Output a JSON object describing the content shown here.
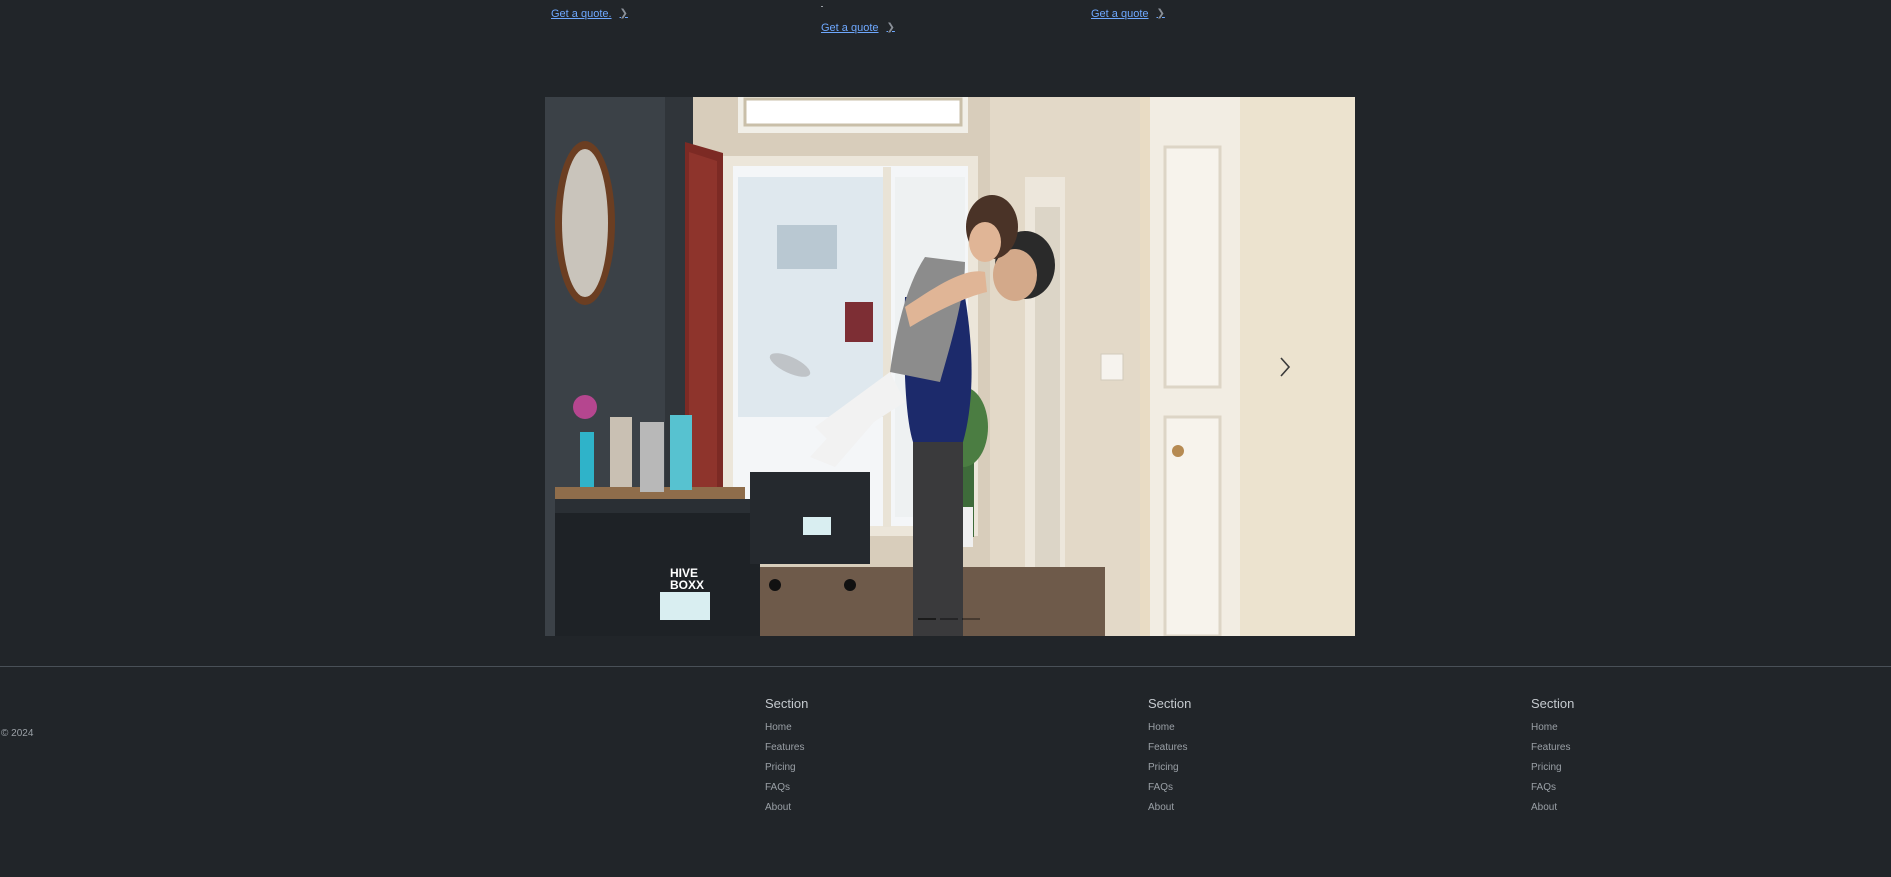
{
  "quotes": [
    {
      "label": "Get a quote."
    },
    {
      "label": "Get a quote"
    },
    {
      "label": "Get a quote"
    }
  ],
  "carousel": {
    "slide_alt": "Couple embracing in the hallway of a new home with moving boxes",
    "box_brand": "HIVE BOXX",
    "slide_count": 3,
    "active_slide": 2
  },
  "footer": {
    "copyright": "© 2024",
    "columns": [
      {
        "heading": "Section",
        "links": [
          "Home",
          "Features",
          "Pricing",
          "FAQs",
          "About"
        ]
      },
      {
        "heading": "Section",
        "links": [
          "Home",
          "Features",
          "Pricing",
          "FAQs",
          "About"
        ]
      },
      {
        "heading": "Section",
        "links": [
          "Home",
          "Features",
          "Pricing",
          "FAQs",
          "About"
        ]
      }
    ]
  },
  "colors": {
    "background": "#212529",
    "link": "#6ea8fe",
    "muted_text": "#9aa0a6",
    "divider": "#495057"
  }
}
